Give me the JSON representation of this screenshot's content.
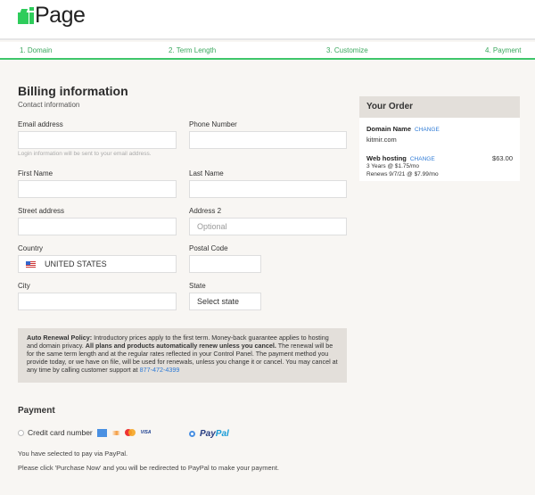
{
  "brand": {
    "name": "Page",
    "accent": "#2ecc5b"
  },
  "steps": [
    {
      "label": "1. Domain"
    },
    {
      "label": "2. Term Length"
    },
    {
      "label": "3. Customize"
    },
    {
      "label": "4. Payment"
    }
  ],
  "billing": {
    "title": "Billing information",
    "subtitle": "Contact information",
    "email_label": "Email address",
    "email_value": "",
    "email_hint": "Login information will be sent to your email address.",
    "phone_label": "Phone Number",
    "phone_value": "",
    "first_name_label": "First Name",
    "last_name_label": "Last Name",
    "street_label": "Street address",
    "address2_label": "Address 2",
    "address2_placeholder": "Optional",
    "country_label": "Country",
    "country_value": "UNITED STATES",
    "postal_label": "Postal Code",
    "city_label": "City",
    "state_label": "State",
    "state_value": "Select state"
  },
  "policy": {
    "heading": "Auto Renewal Policy:",
    "text1": " Introductory prices apply to the first term. Money-back guarantee applies to hosting and domain privacy. ",
    "bold": "All plans and products automatically renew unless you cancel.",
    "text2": " The renewal will be for the same term length and at the regular rates reflected in your Control Panel. The payment method you provide today, or we have on file, will be used for renewals, unless you change it or cancel. You may cancel at any time by calling customer support at ",
    "phone": "877-472-4399"
  },
  "order": {
    "title": "Your Order",
    "domain_label": "Domain Name",
    "domain_change": "CHANGE",
    "domain_value": "kitmir.com",
    "hosting_label": "Web hosting",
    "hosting_change": "CHANGE",
    "hosting_price": "$63.00",
    "hosting_term": "3 Years @ $1.75/mo",
    "hosting_renew": "Renews 9/7/21 @ $7.99/mo"
  },
  "payment": {
    "title": "Payment",
    "credit_label": "Credit card number",
    "cards": [
      "amex",
      "discover",
      "mastercard",
      "visa"
    ],
    "visa_text": "VISA",
    "paypal_a": "Pay",
    "paypal_b": "Pal",
    "selected": "paypal",
    "note1": "You have selected to pay via PayPal.",
    "note2": "Please click 'Purchase Now' and you will be redirected to PayPal to make your payment."
  }
}
